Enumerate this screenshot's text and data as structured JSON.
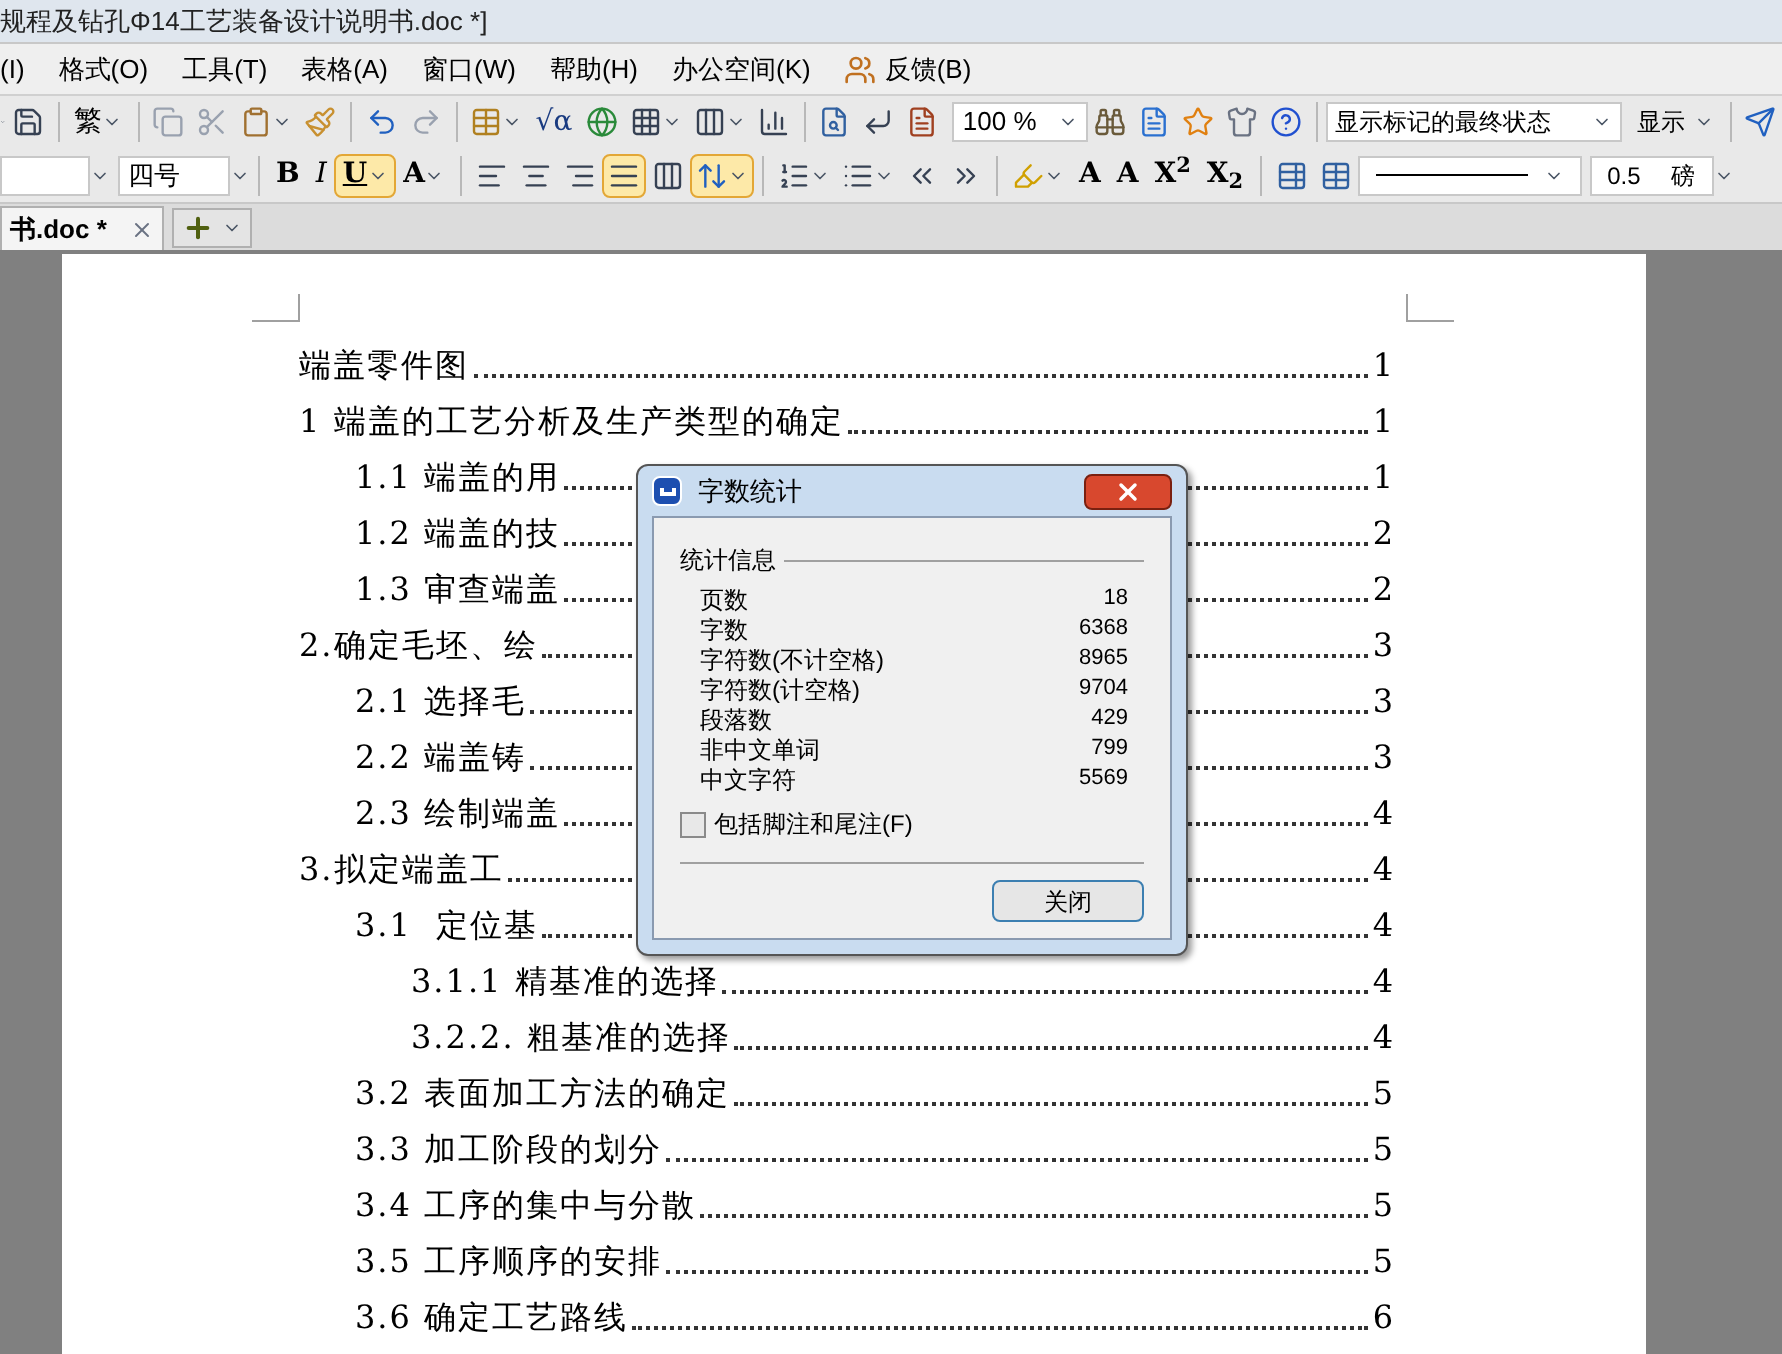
{
  "window": {
    "title": "规程及钻孔Φ14工艺装备设计说明书.doc *]"
  },
  "menu": [
    {
      "label": "(I)"
    },
    {
      "label": "格式(O)"
    },
    {
      "label": "工具(T)"
    },
    {
      "label": "表格(A)"
    },
    {
      "label": "窗口(W)"
    },
    {
      "label": "帮助(H)"
    },
    {
      "label": "办公空间(K)"
    },
    {
      "label": "反馈(B)",
      "kind": "feedback"
    }
  ],
  "toolbar": {
    "traditional": "繁",
    "formula": "√α",
    "zoom": "100 %",
    "markup_view": "显示标记的最终状态",
    "show_menu": "显示"
  },
  "format_bar": {
    "font_size": "四号",
    "bold": {
      "label": "B",
      "selected": false
    },
    "italic": {
      "label": "I",
      "selected": false
    },
    "underline": {
      "label": "U",
      "selected": true
    },
    "text_effect": "A",
    "alignment": [
      {
        "selected": false
      },
      {
        "selected": false
      },
      {
        "selected": false
      },
      {
        "selected": true
      },
      {
        "selected": false
      }
    ],
    "line_spacing": {
      "selected": true
    },
    "grow_font": "A",
    "shrink_font": "A",
    "superscript": "X$^{2}$",
    "subscript": "X$_{2}$",
    "line_weight": "0.5",
    "line_unit": "磅"
  },
  "tabs": [
    {
      "label": "书.doc *",
      "selected": true
    }
  ],
  "toc": [
    {
      "text": "端盖零件图",
      "page": "1"
    },
    {
      "text": "1 端盖的工艺分析及生产类型的确定",
      "page": "1",
      "children": [
        {
          "text": "1.1 端盖的用",
          "page": "1"
        },
        {
          "text": "1.2 端盖的技",
          "page": "2"
        },
        {
          "text": "1.3 审查端盖",
          "page": "2"
        }
      ]
    },
    {
      "text": "2.确定毛坯、绘",
      "page": "3",
      "children": [
        {
          "text": "2.1 选择毛",
          "page": "3"
        },
        {
          "text": "2.2 端盖铸",
          "page": "3"
        },
        {
          "text": "2.3 绘制端盖",
          "page": "4"
        }
      ]
    },
    {
      "text": "3.拟定端盖工",
      "page": "4",
      "children": [
        {
          "text": "3.1  定位基",
          "page": "4",
          "children": [
            {
              "text": "3.1.1 精基准的选择",
              "page": "4"
            },
            {
              "text": "3.2.2. 粗基准的选择",
              "page": "4"
            }
          ]
        },
        {
          "text": "3.2 表面加工方法的确定",
          "page": "5"
        },
        {
          "text": "3.3 加工阶段的划分",
          "page": "5"
        },
        {
          "text": "3.4 工序的集中与分散",
          "page": "5"
        },
        {
          "text": "3.5 工序顺序的安排",
          "page": "5"
        },
        {
          "text": "3.6 确定工艺路线",
          "page": "6"
        }
      ]
    }
  ],
  "dialog": {
    "title": "字数统计",
    "group": "统计信息",
    "stats": [
      {
        "label": "页数",
        "value": "18"
      },
      {
        "label": "字数",
        "value": "6368"
      },
      {
        "label": "字符数(不计空格)",
        "value": "8965"
      },
      {
        "label": "字符数(计空格)",
        "value": "9704"
      },
      {
        "label": "段落数",
        "value": "429"
      },
      {
        "label": "非中文单词",
        "value": "799"
      },
      {
        "label": "中文字符",
        "value": "5569"
      }
    ],
    "include_notes": {
      "label": "包括脚注和尾注(F)",
      "checked": false
    },
    "close_button": "关闭"
  }
}
